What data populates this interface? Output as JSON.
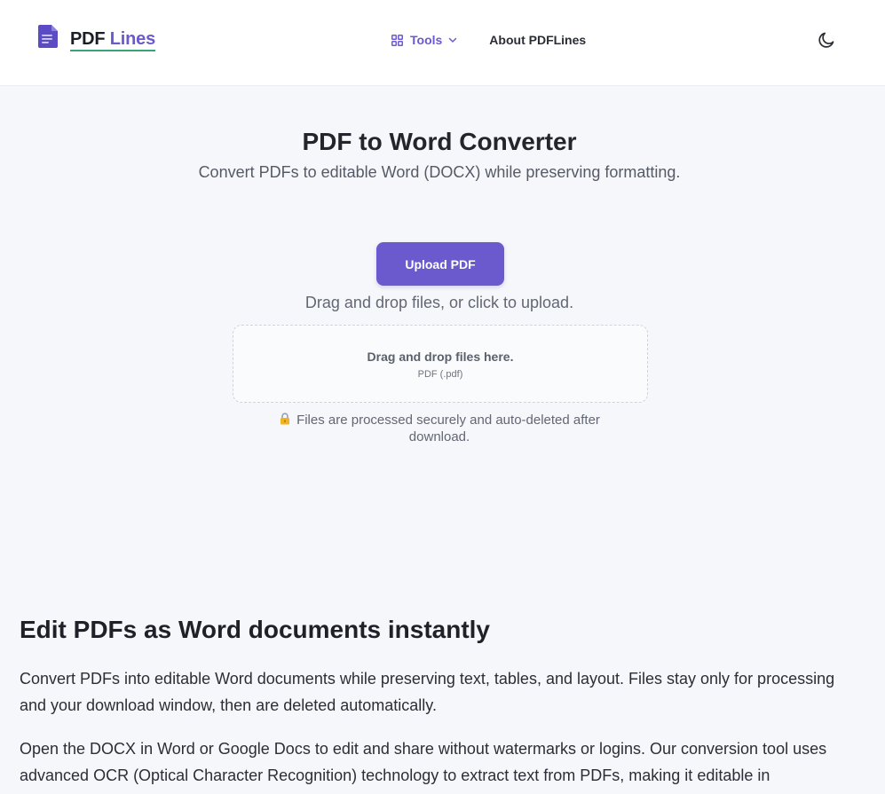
{
  "header": {
    "logo": {
      "word1": "PDF",
      "word2": "Lines"
    },
    "nav": {
      "tools_label": "Tools",
      "about_label": "About PDFLines"
    },
    "icons": {
      "logo": "document-icon",
      "tools": "grid-icon",
      "dropdown": "chevron-down-icon",
      "theme": "moon-icon"
    }
  },
  "hero": {
    "title": "PDF to Word Converter",
    "subtitle": "Convert PDFs to editable Word (DOCX) while preserving formatting.",
    "upload_label": "Upload PDF",
    "drag_hint": "Drag and drop files, or click to upload.",
    "dropzone": {
      "title": "Drag and drop files here.",
      "formats": "PDF (.pdf)"
    },
    "secure_note": "Files are processed securely and auto-deleted after download."
  },
  "content": {
    "heading": "Edit PDFs as Word documents instantly",
    "paragraph1": "Convert PDFs into editable Word documents while preserving text, tables, and layout. Files stay only for processing and your download window, then are deleted automatically.",
    "paragraph2": "Open the DOCX in Word or Google Docs to edit and share without watermarks or logins. Our conversion tool uses advanced OCR (Optical Character Recognition) technology to extract text from PDFs, making it editable in"
  },
  "colors": {
    "accent": "#6a5acd",
    "logo_underline": "#3aa37a",
    "background": "#f6f7fb"
  }
}
